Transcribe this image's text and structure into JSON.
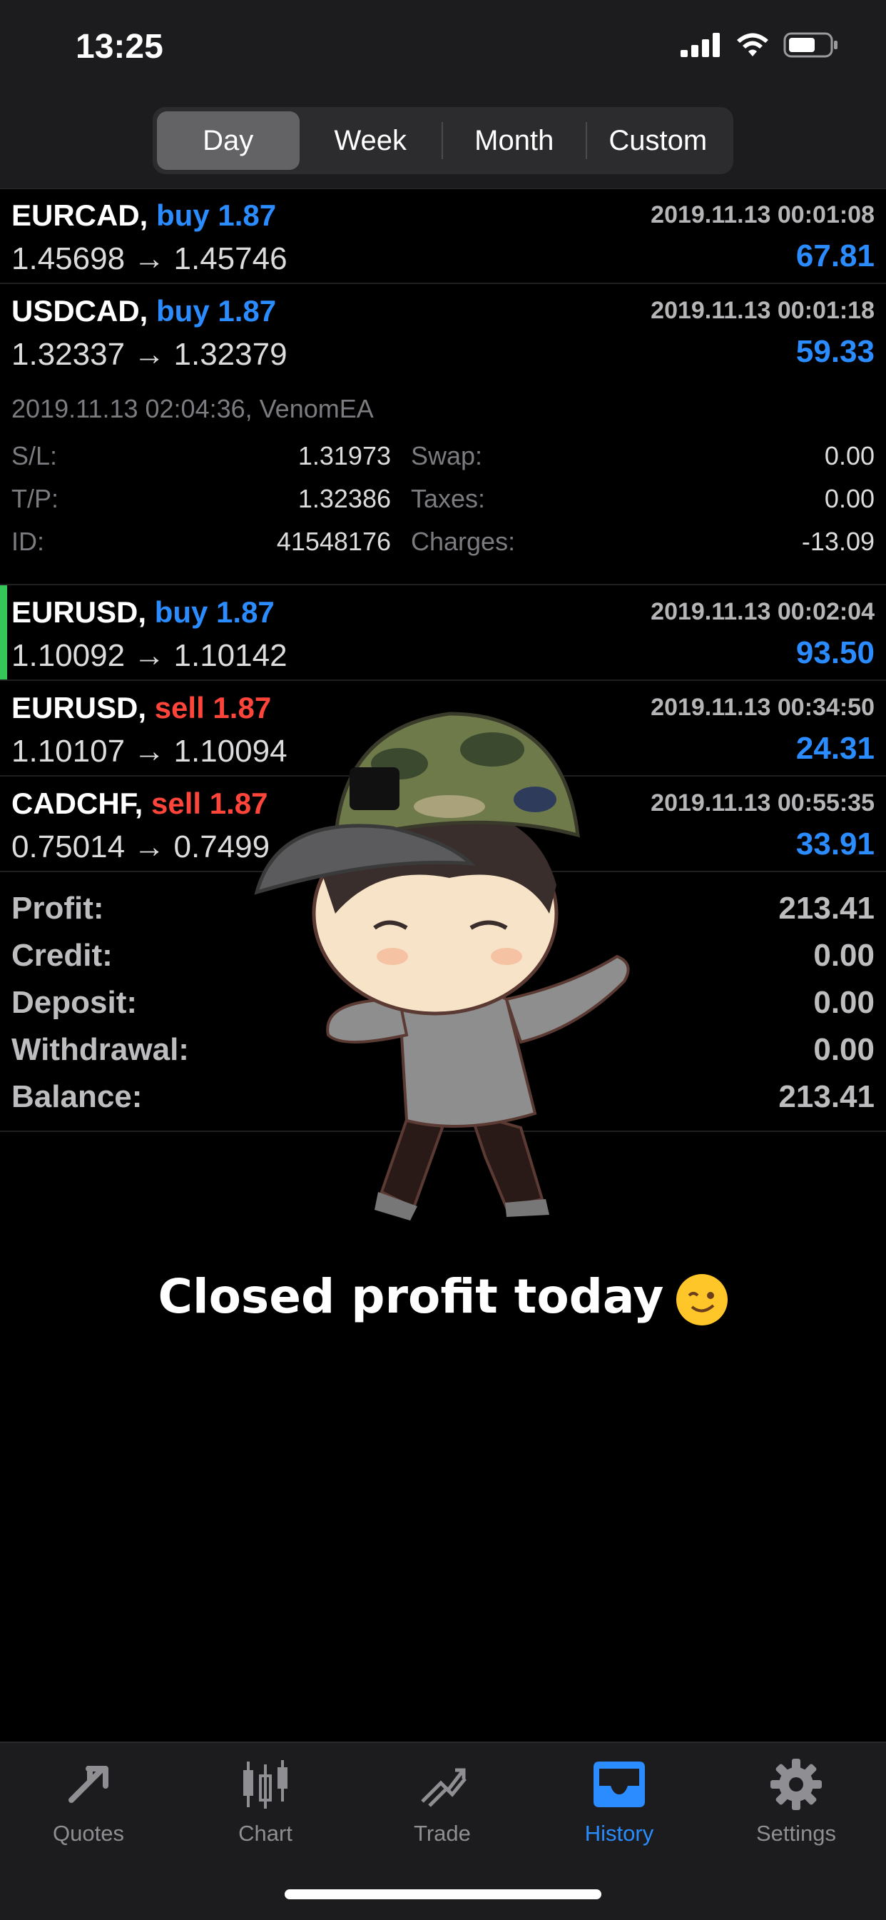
{
  "status": {
    "time": "13:25"
  },
  "period_tabs": [
    {
      "label": "Day",
      "active": true
    },
    {
      "label": "Week",
      "active": false
    },
    {
      "label": "Month",
      "active": false
    },
    {
      "label": "Custom",
      "active": false
    }
  ],
  "trades": [
    {
      "symbol": "EURCAD,",
      "side": "buy 1.87",
      "date": "2019.11.13 00:01:08",
      "prices": "1.45698 → 1.45746",
      "profit": "67.81"
    },
    {
      "symbol": "USDCAD,",
      "side": "buy 1.87",
      "date": "2019.11.13 00:01:18",
      "prices": "1.32337 → 1.32379",
      "profit": "59.33"
    },
    {
      "symbol": "EURUSD,",
      "side": "buy 1.87",
      "date": "2019.11.13 00:02:04",
      "prices": "1.10092 → 1.10142",
      "profit": "93.50"
    },
    {
      "symbol": "EURUSD,",
      "side": "sell 1.87",
      "date": "2019.11.13 00:34:50",
      "prices": "1.10107 → 1.10094",
      "profit": "24.31"
    },
    {
      "symbol": "CADCHF,",
      "side": "sell 1.87",
      "date": "2019.11.13 00:55:35",
      "prices": "0.75014 → 0.7499",
      "profit": "33.91"
    }
  ],
  "details": {
    "info": "2019.11.13 02:04:36, VenomEA",
    "sl_label": "S/L:",
    "sl_value": "1.31973",
    "tp_label": "T/P:",
    "tp_value": "1.32386",
    "id_label": "ID:",
    "id_value": "41548176",
    "swap_label": "Swap:",
    "swap_value": "0.00",
    "taxes_label": "Taxes:",
    "taxes_value": "0.00",
    "charges_label": "Charges:",
    "charges_value": "-13.09"
  },
  "summary": [
    {
      "label": "Profit:",
      "value": "213.41"
    },
    {
      "label": "Credit:",
      "value": "0.00"
    },
    {
      "label": "Deposit:",
      "value": "0.00"
    },
    {
      "label": "Withdrawal:",
      "value": "0.00"
    },
    {
      "label": "Balance:",
      "value": "213.41"
    }
  ],
  "overlay": {
    "caption": "Closed profit today"
  },
  "tabbar": [
    {
      "label": "Quotes",
      "icon": "quotes-icon",
      "active": false
    },
    {
      "label": "Chart",
      "icon": "chart-icon",
      "active": false
    },
    {
      "label": "Trade",
      "icon": "trade-icon",
      "active": false
    },
    {
      "label": "History",
      "icon": "history-icon",
      "active": true
    },
    {
      "label": "Settings",
      "icon": "gear-icon",
      "active": false
    }
  ],
  "colors": {
    "buy": "#2a8cff",
    "sell": "#ff453a",
    "accent": "#2a8cff",
    "highlight_bar": "#35c759"
  }
}
